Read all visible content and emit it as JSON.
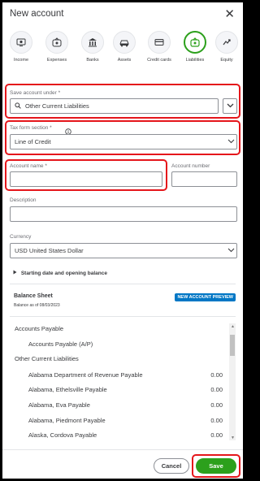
{
  "header": {
    "title": "New account",
    "close_glyph": "✕"
  },
  "account_types": [
    {
      "label": "Income",
      "icon": "income-icon",
      "active": false
    },
    {
      "label": "Expenses",
      "icon": "expenses-icon",
      "active": false
    },
    {
      "label": "Banks",
      "icon": "banks-icon",
      "active": false
    },
    {
      "label": "Assets",
      "icon": "assets-icon",
      "active": false
    },
    {
      "label": "Credit cards",
      "icon": "credit-card-icon",
      "active": false
    },
    {
      "label": "Liabilities",
      "icon": "liabilities-icon",
      "active": true
    },
    {
      "label": "Equity",
      "icon": "equity-icon",
      "active": false
    }
  ],
  "form": {
    "save_under_label": "Save account under *",
    "save_under_value": "Other Current Liabilities",
    "tax_form_label": "Tax form section *",
    "tax_form_value": "Line of Credit",
    "account_name_label": "Account name *",
    "account_name_value": "",
    "account_number_label": "Account number",
    "account_number_value": "",
    "description_label": "Description",
    "description_value": "",
    "currency_label": "Currency",
    "currency_value": "USD United States Dollar",
    "starting_toggle": "Starting date and opening balance"
  },
  "balance_sheet": {
    "title": "Balance Sheet",
    "subtitle": "Balance as of 08/03/2023",
    "badge": "NEW ACCOUNT PREVIEW",
    "rows": [
      {
        "name": "Accounts Payable",
        "amount": "",
        "indent": 0
      },
      {
        "name": "Accounts Payable (A/P)",
        "amount": "",
        "indent": 1
      },
      {
        "name": "Other Current Liabilities",
        "amount": "",
        "indent": 0
      },
      {
        "name": "Alabama Department of Revenue Payable",
        "amount": "0.00",
        "indent": 1
      },
      {
        "name": "Alabama, Ethelsville Payable",
        "amount": "0.00",
        "indent": 1
      },
      {
        "name": "Alabama, Eva Payable",
        "amount": "0.00",
        "indent": 1
      },
      {
        "name": "Alabama, Piedmont Payable",
        "amount": "0.00",
        "indent": 1
      },
      {
        "name": "Alaska, Cordova Payable",
        "amount": "0.00",
        "indent": 1
      }
    ]
  },
  "footer": {
    "cancel_label": "Cancel",
    "save_label": "Save"
  },
  "colors": {
    "accent_green": "#2ca01c",
    "highlight_red": "#e5161b",
    "badge_blue": "#0077c5"
  }
}
